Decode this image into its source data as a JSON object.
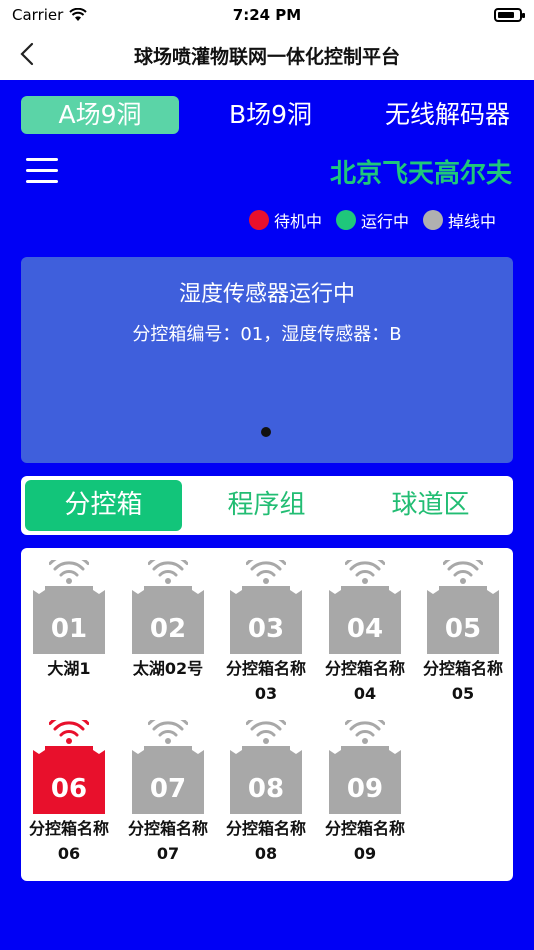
{
  "status_bar": {
    "carrier": "Carrier",
    "time": "7:24 PM"
  },
  "nav": {
    "title": "球场喷灌物联网一体化控制平台"
  },
  "top_tabs": [
    {
      "label": "A场9洞"
    },
    {
      "label": "B场9洞"
    },
    {
      "label": "无线解码器"
    }
  ],
  "brand": "北京飞天高尔夫",
  "legend": [
    {
      "label": "待机中",
      "color": "#e8102c"
    },
    {
      "label": "运行中",
      "color": "#1fc77b"
    },
    {
      "label": "掉线中",
      "color": "#b0b0b0"
    }
  ],
  "banner": {
    "line1": "湿度传感器运行中",
    "line2": "分控箱编号：01，湿度传感器：B"
  },
  "segments": [
    {
      "label": "分控箱"
    },
    {
      "label": "程序组"
    },
    {
      "label": "球道区"
    }
  ],
  "boxes": [
    {
      "num": "01",
      "name": "大湖1",
      "state": "offline"
    },
    {
      "num": "02",
      "name": "太湖02号",
      "state": "offline"
    },
    {
      "num": "03",
      "name": "分控箱名称03",
      "state": "offline"
    },
    {
      "num": "04",
      "name": "分控箱名称04",
      "state": "offline"
    },
    {
      "num": "05",
      "name": "分控箱名称05",
      "state": "offline"
    },
    {
      "num": "06",
      "name": "分控箱名称06",
      "state": "standby"
    },
    {
      "num": "07",
      "name": "分控箱名称07",
      "state": "offline"
    },
    {
      "num": "08",
      "name": "分控箱名称08",
      "state": "offline"
    },
    {
      "num": "09",
      "name": "分控箱名称09",
      "state": "offline"
    }
  ],
  "battery_level": 0.8
}
